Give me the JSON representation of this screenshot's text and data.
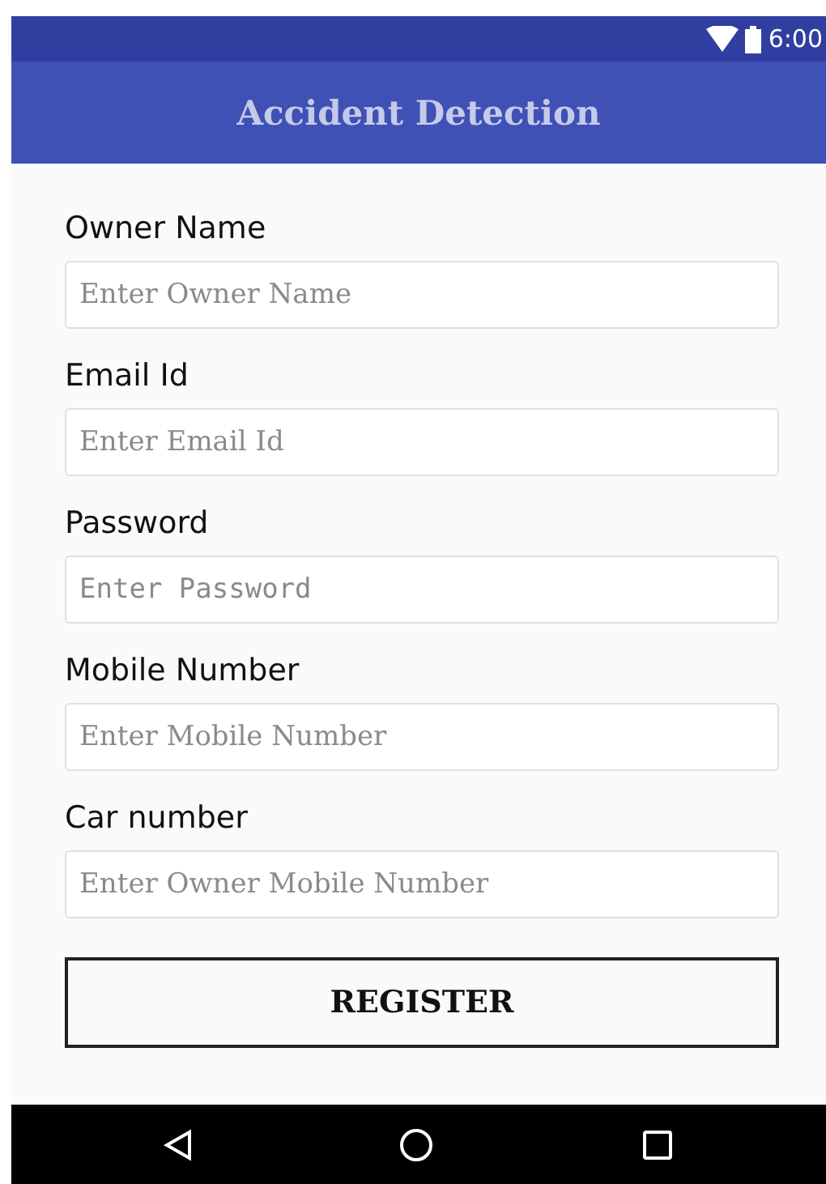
{
  "status_bar": {
    "time": "6:00"
  },
  "app_bar": {
    "title": "Accident Detection"
  },
  "fields": [
    {
      "label": "Owner Name",
      "placeholder": "Enter Owner Name",
      "kind": "text"
    },
    {
      "label": "Email Id",
      "placeholder": "Enter Email Id",
      "kind": "text"
    },
    {
      "label": "Password",
      "placeholder": "Enter Password",
      "kind": "password"
    },
    {
      "label": "Mobile Number",
      "placeholder": "Enter Mobile Number",
      "kind": "text"
    },
    {
      "label": "Car number",
      "placeholder": "Enter Owner Mobile Number",
      "kind": "text"
    }
  ],
  "button": "REGISTER"
}
